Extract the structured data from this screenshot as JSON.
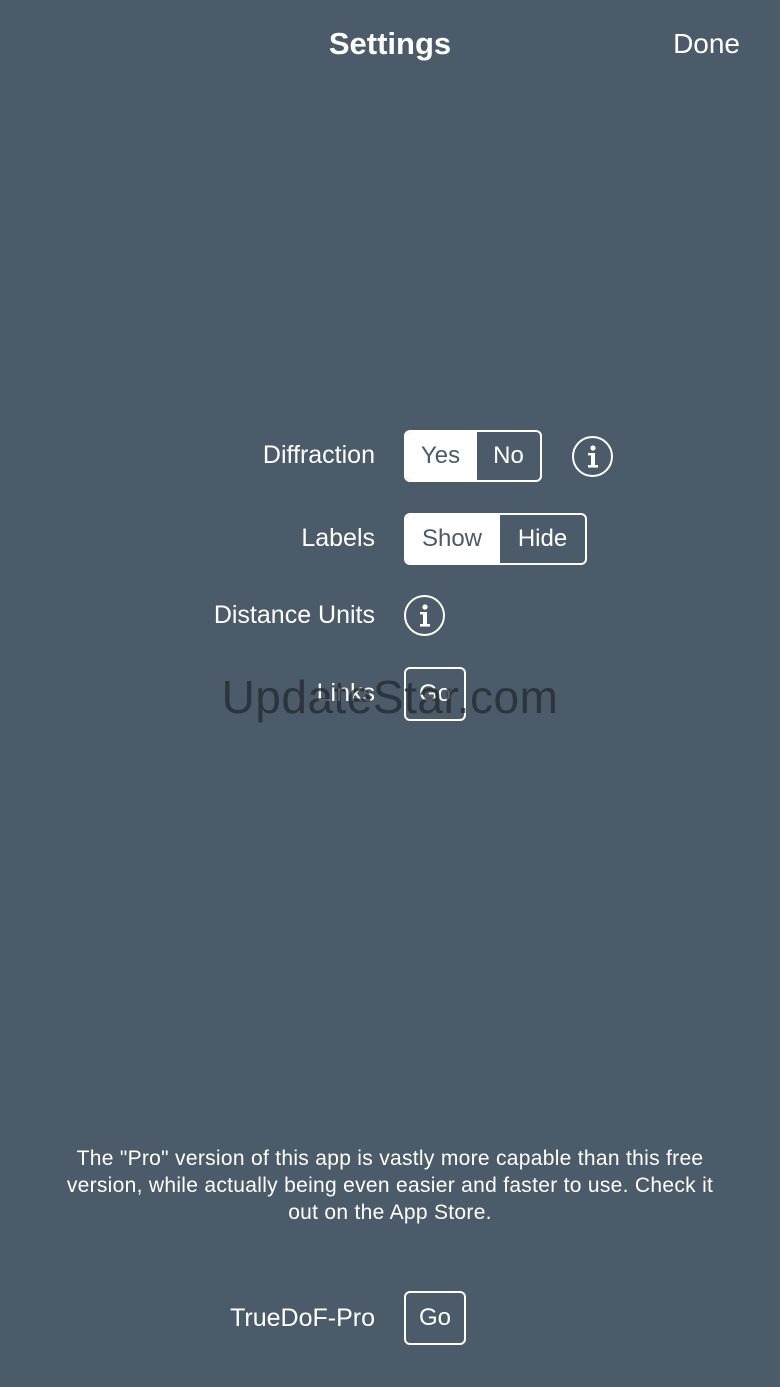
{
  "nav": {
    "title": "Settings",
    "done_label": "Done"
  },
  "settings": {
    "diffraction": {
      "label": "Diffraction",
      "options": [
        "Yes",
        "No"
      ],
      "selected": "Yes",
      "info_icon": "info-icon"
    },
    "labels": {
      "label": "Labels",
      "options": [
        "Show",
        "Hide"
      ],
      "selected": "Show"
    },
    "distance_units": {
      "label": "Distance Units",
      "info_icon": "info-icon"
    },
    "links": {
      "label": "Links",
      "go_label": "Go"
    }
  },
  "watermark": "UpdateStar.com",
  "promo": {
    "text": "The \"Pro\" version of this app is vastly more capable than this free version, while actually being even easier and faster to use. Check it out on the App Store.",
    "pro_label": "TrueDoF-Pro",
    "go_label": "Go"
  },
  "colors": {
    "background": "#4b5b69",
    "foreground": "#ffffff"
  }
}
